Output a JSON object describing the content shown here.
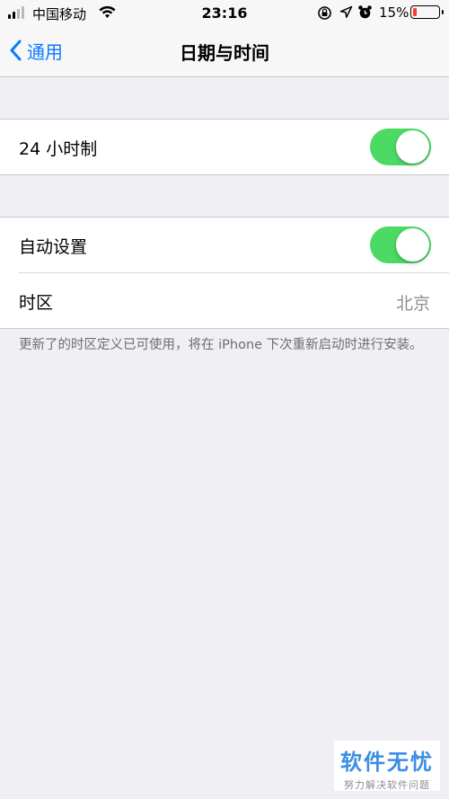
{
  "status_bar": {
    "carrier": "中国移动",
    "time": "23:16",
    "battery_percent": "15%",
    "battery_level": 0.15,
    "icons": [
      "signal-icon",
      "wifi-icon",
      "rotation-lock-icon",
      "location-icon",
      "alarm-icon",
      "battery-icon"
    ]
  },
  "nav": {
    "back_label": "通用",
    "title": "日期与时间"
  },
  "groups": {
    "clock": {
      "label": "24 小时制",
      "toggle_on": true
    },
    "auto": {
      "auto_label": "自动设置",
      "auto_on": true,
      "timezone_label": "时区",
      "timezone_value": "北京"
    }
  },
  "footnote": "更新了的时区定义已可使用，将在 iPhone 下次重新启动时进行安装。",
  "watermark": {
    "title": "软件无忧",
    "subtitle": "努力解决软件问题"
  },
  "colors": {
    "accent": "#0a7aff",
    "toggle_on": "#4cd964",
    "battery_low": "#ff3b30",
    "background": "#efeff4"
  }
}
